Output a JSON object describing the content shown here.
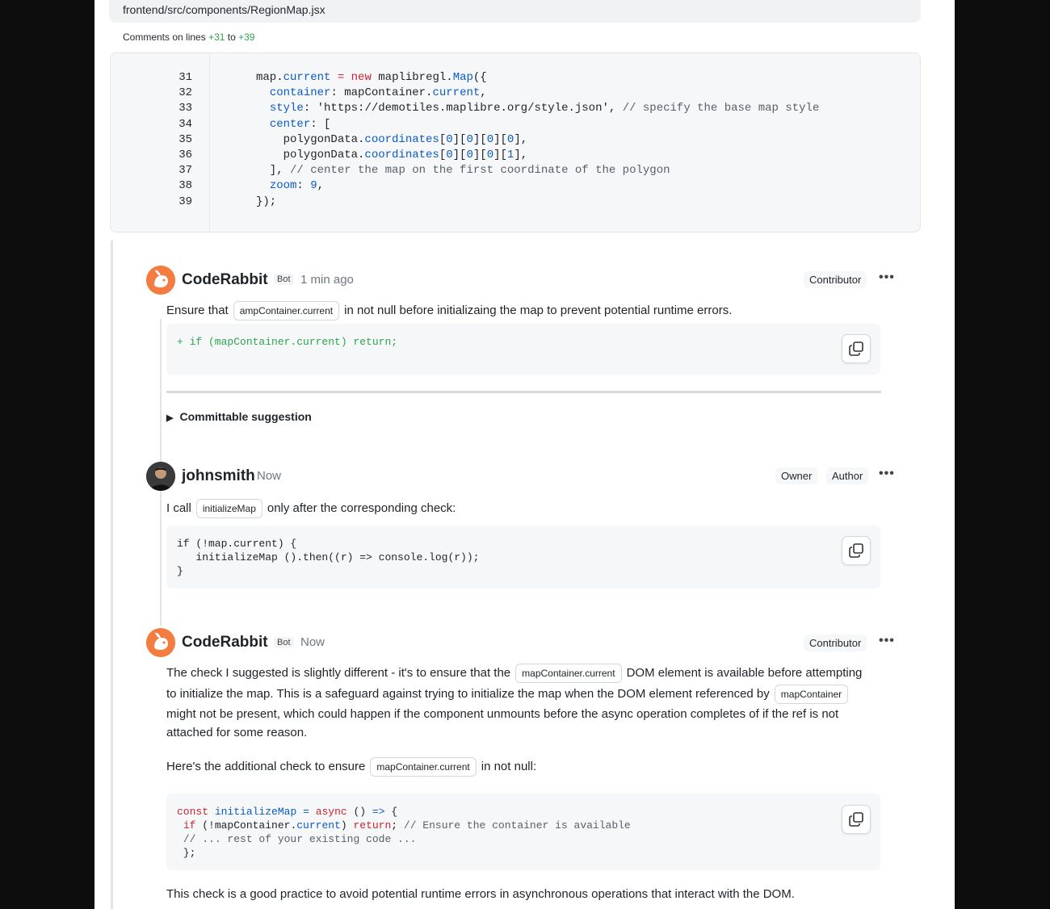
{
  "file": {
    "path": "frontend/src/components/RegionMap.jsx",
    "comments_prefix": "Comments on lines",
    "line_start": "+31",
    "to": "to",
    "line_end": "+39"
  },
  "code": {
    "line_numbers": [
      "31",
      "32",
      "33",
      "34",
      "35",
      "36",
      "37",
      "38",
      "39"
    ]
  },
  "comments": [
    {
      "author": "CodeRabbit",
      "badge": "Bot",
      "time": "1 min ago",
      "role": "Contributor",
      "text_before": "Ensure that",
      "chip": "ampContainer.current",
      "text_after": "in not null before initializaing the map to prevent potential runtime errors.",
      "suggestion_code": "+ if (mapContainer.current) return;",
      "summary": "Committable suggestion"
    },
    {
      "author": "johnsmith",
      "time": "Now",
      "role_owner": "Owner",
      "role_author": "Author",
      "text_before": "I call",
      "chip": "initializeMap",
      "text_after": "only after the corresponding check:"
    },
    {
      "author": "CodeRabbit",
      "badge": "Bot",
      "time": "Now",
      "role": "Contributor",
      "p1_a": "The check I suggested is slightly different - it's to ensure that the",
      "p1_chip": "mapContainer.current",
      "p1_b": "DOM element is available before attempting",
      "p2_a": "to initialize the map. This is a safeguard against trying to initialize the map when the DOM element referenced by",
      "p2_chip": "mapContainer",
      "p3": "might not be present, which could happen if the component unmounts before the async operation completes of if the ref is not",
      "p4": "attached for some reason.",
      "p5_a": "Here's the additional check to ensure",
      "p5_chip": "mapContainer.current",
      "p5_b": "in not null:",
      "p6": "This check is a good practice to avoid potential runtime errors in asynchronous operations that interact with the DOM."
    }
  ],
  "icons": [
    "coderabbit-avatar-icon",
    "user-avatar-icon",
    "copy-icon",
    "more-icon",
    "expand-triangle-icon"
  ]
}
